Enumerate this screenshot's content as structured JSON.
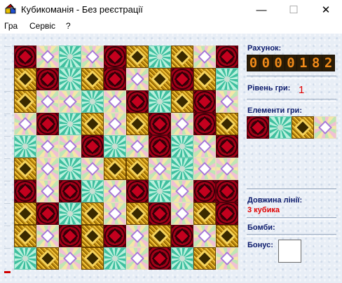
{
  "window": {
    "title": "Кубикоманія - Без реєстрації",
    "min_glyph": "—",
    "max_glyph": "☐",
    "close_glyph": "✕"
  },
  "menu": [
    "Гра",
    "Сервіс",
    "?"
  ],
  "board": {
    "rows": 10,
    "cols": 10,
    "cells": [
      [
        "red",
        "pastel",
        "teal",
        "pastel",
        "red",
        "gold",
        "teal",
        "gold",
        "pastel",
        "red"
      ],
      [
        "gold",
        "red",
        "teal",
        "gold",
        "red",
        "pastel",
        "gold",
        "red",
        "gold",
        "teal"
      ],
      [
        "gold",
        "pastel",
        "pastel",
        "teal",
        "pastel",
        "red",
        "teal",
        "gold",
        "red",
        "pastel"
      ],
      [
        "pastel",
        "red",
        "teal",
        "gold",
        "pastel",
        "gold",
        "red",
        "pastel",
        "red",
        "gold"
      ],
      [
        "teal",
        "pastel",
        "pastel",
        "red",
        "teal",
        "pastel",
        "red",
        "teal",
        "pastel",
        "red"
      ],
      [
        "gold",
        "pastel",
        "teal",
        "pastel",
        "gold",
        "gold",
        "pastel",
        "teal",
        "pastel",
        "pastel"
      ],
      [
        "red",
        "pastel",
        "red",
        "teal",
        "pastel",
        "red",
        "teal",
        "pastel",
        "red",
        "red"
      ],
      [
        "gold",
        "red",
        "teal",
        "gold",
        "pastel",
        "gold",
        "red",
        "pastel",
        "gold",
        "red"
      ],
      [
        "gold",
        "pastel",
        "red",
        "gold",
        "red",
        "pastel",
        "gold",
        "red",
        "pastel",
        "gold"
      ],
      [
        "teal",
        "gold",
        "pastel",
        "gold",
        "teal",
        "pastel",
        "red",
        "teal",
        "gold",
        "pastel"
      ]
    ]
  },
  "panel": {
    "score_label": "Рахунок:",
    "score_digits": [
      "0",
      "0",
      "0",
      "0",
      "1",
      "8",
      "2"
    ],
    "level_label": "Рівень гри:",
    "level_value": "1",
    "elements_label": "Елементи гри:",
    "elements": [
      "red",
      "teal",
      "gold",
      "pastel"
    ],
    "line_label": "Довжина лінії:",
    "line_value": "3 кубика",
    "bombs_label": "Бомби:",
    "bonus_label": "Бонус:"
  }
}
